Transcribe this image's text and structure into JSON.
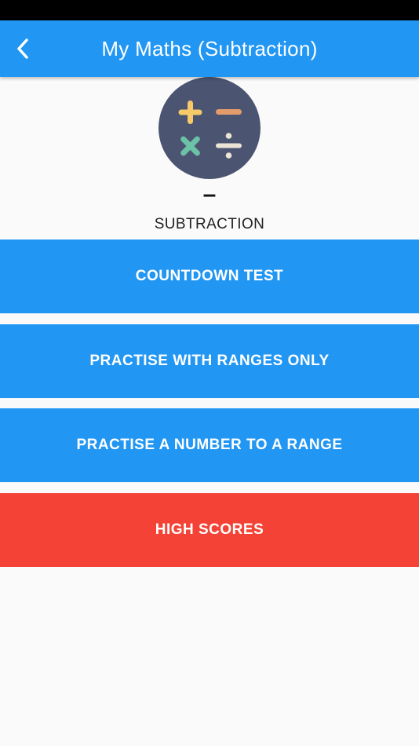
{
  "header": {
    "title": "My Maths (Subtraction)",
    "back_icon": "chevron-left-icon",
    "color": "#2196f3"
  },
  "operation": {
    "symbol": "–",
    "name": "SUBTRACTION",
    "logo_icons": [
      "plus-icon",
      "minus-icon",
      "times-icon",
      "divide-icon"
    ]
  },
  "menu": {
    "countdown_label": "COUNTDOWN TEST",
    "ranges_label": "PRACTISE WITH RANGES ONLY",
    "number_range_label": "PRACTISE A NUMBER TO A RANGE",
    "high_scores_label": "HIGH SCORES"
  },
  "colors": {
    "primary": "#2196f3",
    "danger": "#f44336",
    "logo_bg": "#4b5572",
    "plus": "#f6c969",
    "minus": "#e49c6c",
    "times": "#6cc2a6",
    "divide": "#ece5d5"
  }
}
